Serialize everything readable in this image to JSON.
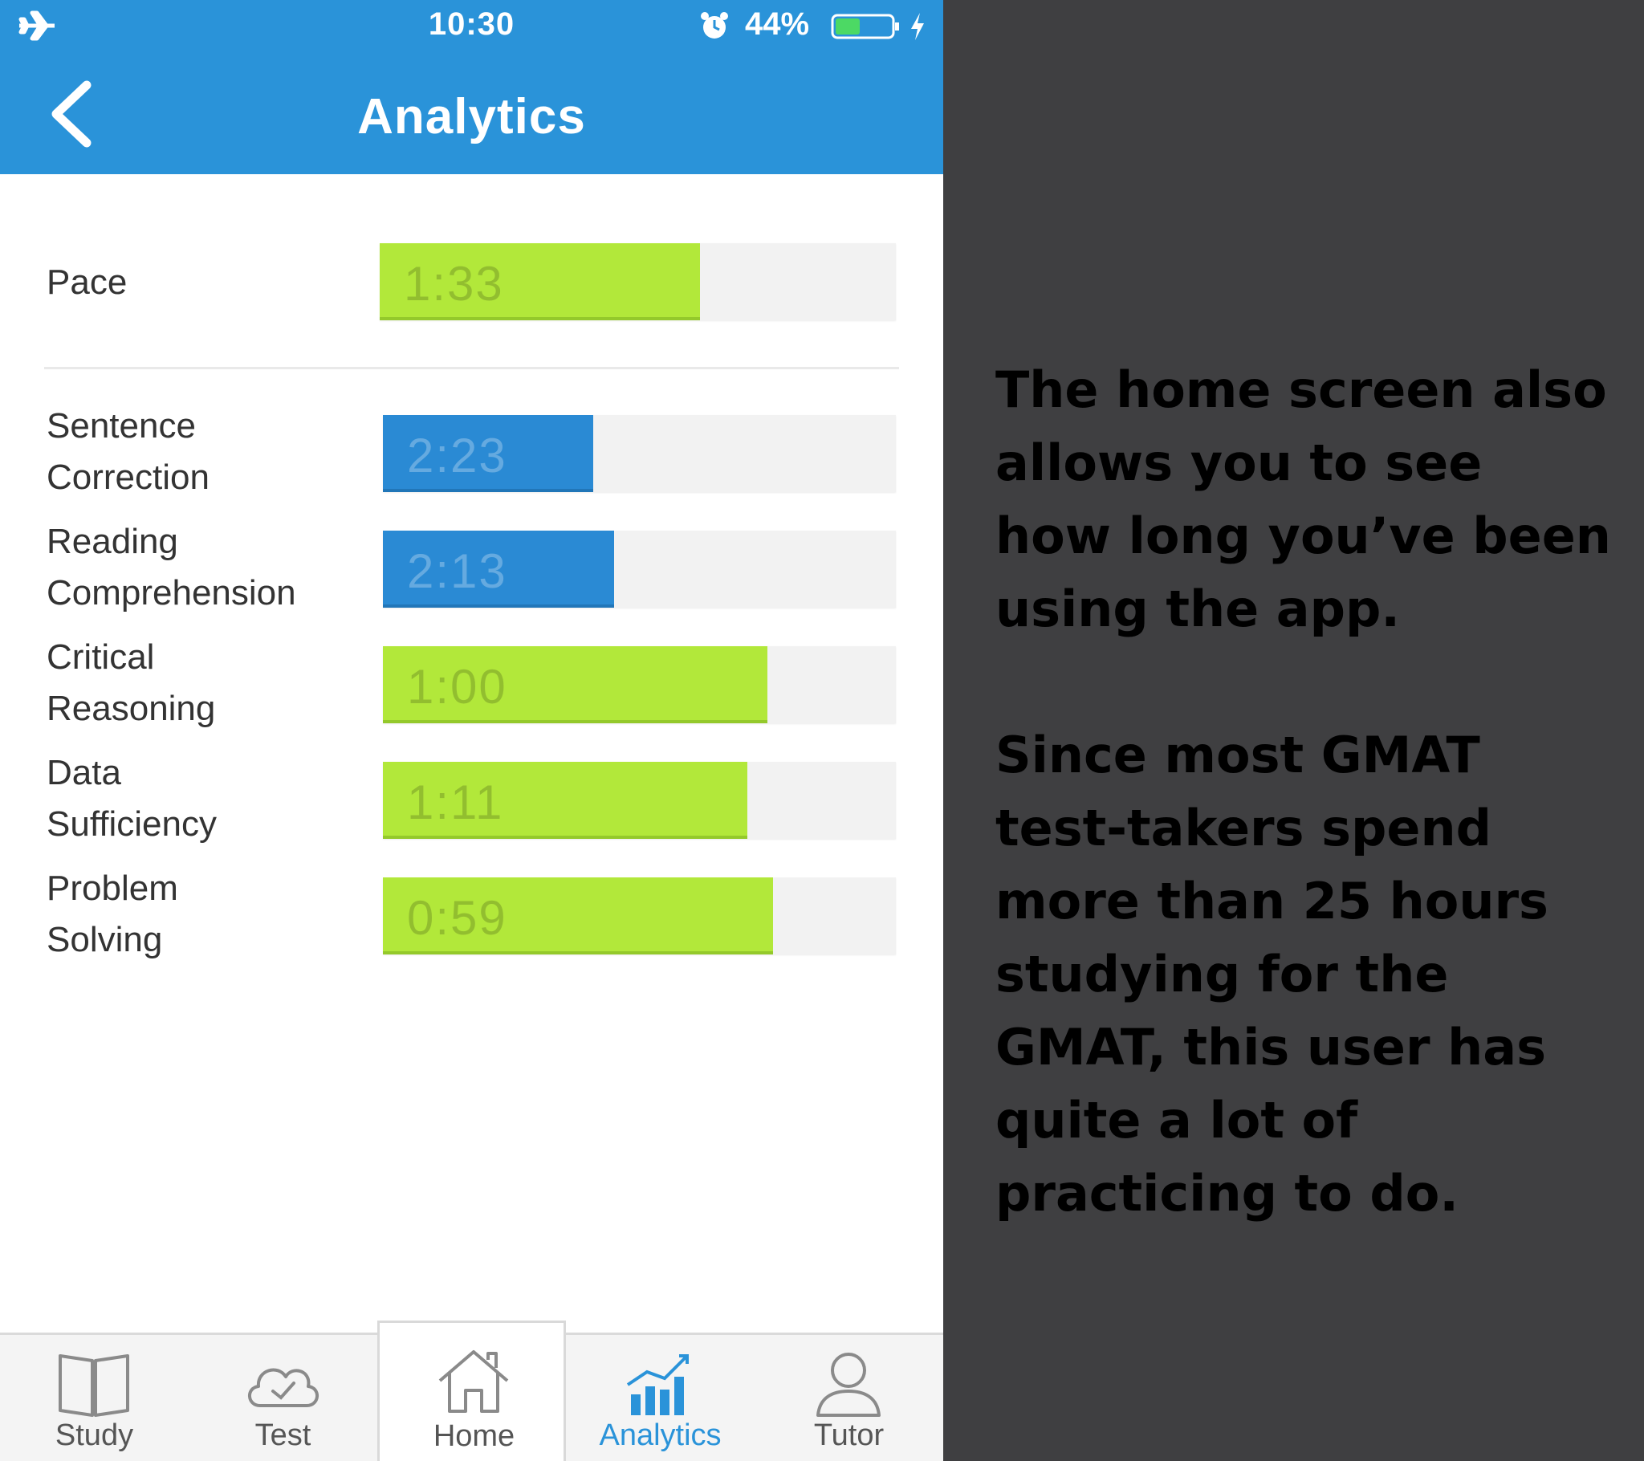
{
  "status_bar": {
    "time": "10:30",
    "battery_percent": "44%",
    "battery_level": 0.44,
    "icons": [
      "airplane-icon",
      "alarm-icon",
      "battery-icon",
      "charging-bolt-icon"
    ]
  },
  "nav": {
    "title": "Analytics",
    "back_icon": "chevron-left-icon"
  },
  "pace": {
    "label": "Pace",
    "value": "1:33",
    "fill_fraction": 0.62,
    "color": "#b2e83a"
  },
  "categories": [
    {
      "label_line1": "Sentence",
      "label_line2": "Correction",
      "value": "2:23",
      "fill_fraction": 0.41,
      "color": "blue"
    },
    {
      "label_line1": "Reading",
      "label_line2": "Comprehension",
      "value": "2:13",
      "fill_fraction": 0.45,
      "color": "blue"
    },
    {
      "label_line1": "Critical",
      "label_line2": "Reasoning",
      "value": "1:00",
      "fill_fraction": 0.75,
      "color": "green"
    },
    {
      "label_line1": "Data",
      "label_line2": "Sufficiency",
      "value": "1:11",
      "fill_fraction": 0.71,
      "color": "green"
    },
    {
      "label_line1": "Problem",
      "label_line2": "Solving",
      "value": "0:59",
      "fill_fraction": 0.76,
      "color": "green"
    }
  ],
  "colors": {
    "header_blue": "#2a93d9",
    "bar_green": "#b2e83a",
    "bar_blue": "#2a8ad4",
    "side_background": "#3f3f41"
  },
  "tabs": [
    {
      "label": "Study",
      "icon": "book-icon",
      "active": false
    },
    {
      "label": "Test",
      "icon": "cloud-check-icon",
      "active": false
    },
    {
      "label": "Home",
      "icon": "house-icon",
      "active": false
    },
    {
      "label": "Analytics",
      "icon": "bar-chart-icon",
      "active": true
    },
    {
      "label": "Tutor",
      "icon": "person-icon",
      "active": false
    }
  ],
  "side_text": {
    "paragraph1": "The home screen also allows you to see how long you’ve been using the app.",
    "paragraph2": "Since most GMAT test-takers spend more than 25 hours studying for the GMAT, this user has quite a lot of practicing to do."
  }
}
